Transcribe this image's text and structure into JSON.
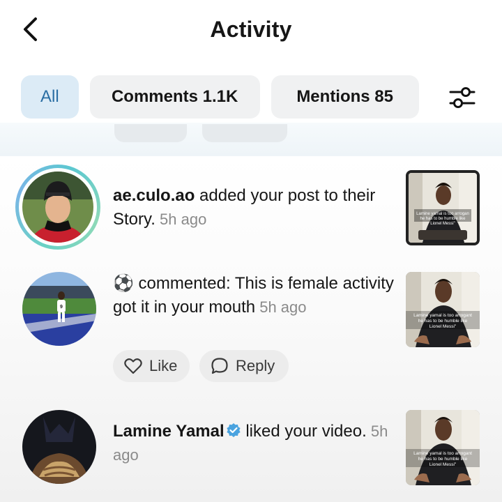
{
  "header": {
    "title": "Activity"
  },
  "tabs": [
    {
      "label": "All",
      "active": true
    },
    {
      "label": "Comments 1.1K",
      "active": false
    },
    {
      "label": "Mentions 85",
      "active": false
    }
  ],
  "icons": {
    "back": "chevron-left-icon",
    "filter": "sliders-icon",
    "like": "heart-outline-icon",
    "reply": "speech-bubble-icon",
    "verified": "verified-badge-icon",
    "emoji": "soccer-ball-emoji"
  },
  "colors": {
    "active_tab_bg": "#dcebf6",
    "active_tab_text": "#2a6ea3",
    "verified": "#4aa3df",
    "story_ring": "#79b5e6"
  },
  "notifications": [
    {
      "username": "ae.culo.ao",
      "message": " added your post to their Story.",
      "time": " 5h ago",
      "thumb_caption": "Lamine yamal is too arrogant he has to be humble like Lionel Messi"
    },
    {
      "emoji": "⚽",
      "message": " commented: This is female activity got it in your mouth",
      "time": " 5h ago",
      "actions": {
        "like": "Like",
        "reply": "Reply"
      },
      "thumb_caption": "Lamine yamal is too arrogant he has to be humble like Lionel Messi"
    },
    {
      "username": "Lamine Yamal",
      "verified": true,
      "message": " liked your video.",
      "time": " 5h ago",
      "thumb_caption": "Lamine yamal is too arrogant he has to be humble like Lionel Messi"
    }
  ]
}
